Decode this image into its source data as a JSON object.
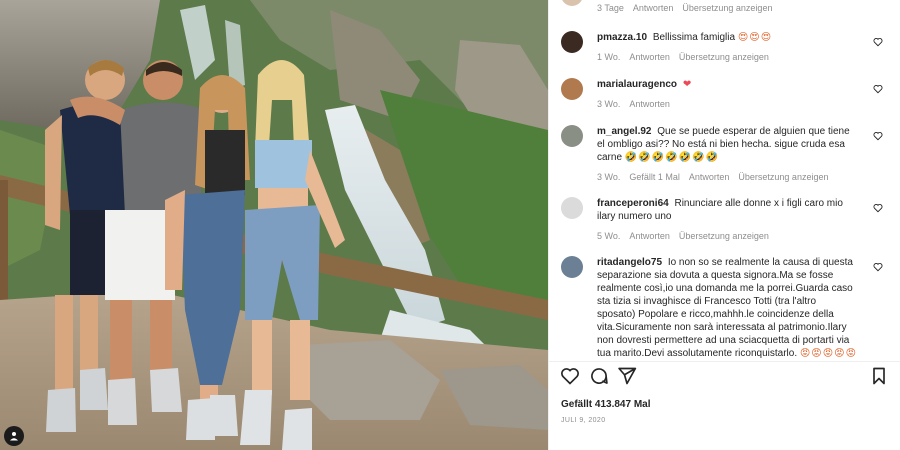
{
  "post": {
    "likes_text": "Gefällt 413.847 Mal",
    "date_text": "JULI 9, 2020"
  },
  "top_meta": {
    "time": "3 Tage",
    "reply": "Antworten",
    "translate": "Übersetzung anzeigen"
  },
  "comments": [
    {
      "user": "pmazza.10",
      "text": "Bellissima famiglia",
      "emoji": "😍😍😍",
      "time": "1 Wo.",
      "likes": "",
      "reply": "Antworten",
      "translate": "Übersetzung anzeigen",
      "avatar_color": "#3b2a22"
    },
    {
      "user": "marialauragenco",
      "text": "",
      "emoji": "❤",
      "time": "3 Wo.",
      "likes": "",
      "reply": "Antworten",
      "translate": "",
      "avatar_color": "#b07a4e"
    },
    {
      "user": "m_angel.92",
      "text": "Que se puede esperar de alguien que tiene el ombligo asi?? No está ni bien hecha. sigue cruda esa carne",
      "emoji": "🤣🤣🤣🤣🤣🤣🤣",
      "time": "3 Wo.",
      "likes": "Gefällt 1 Mal",
      "reply": "Antworten",
      "translate": "Übersetzung anzeigen",
      "avatar_color": "#8a8f86"
    },
    {
      "user": "franceperoni64",
      "text": "Rinunciare alle donne x i figli caro mio ilary numero uno",
      "emoji": "",
      "time": "5 Wo.",
      "likes": "",
      "reply": "Antworten",
      "translate": "Übersetzung anzeigen",
      "avatar_color": "#dbdbdb"
    },
    {
      "user": "ritadangelo75",
      "text": "Io non so se realmente la causa di questa separazione sia dovuta a questa signora.Ma se fosse realmente così,io una domanda me la porrei.Guarda caso sta tizia si invaghisce di Francesco Totti (tra l'altro sposato) Popolare e ricco,mahhh.le coincidenze della vita.Sicuramente non sarà interessata al patrimonio.Ilary non dovresti permettere ad una sciacquetta di portarti via tua marito.Devi assolutamente riconquistarlo.",
      "emoji": "😡😡😡😡😡",
      "time": "",
      "likes": "",
      "reply": "",
      "translate": "",
      "avatar_color": "#6b7f95"
    }
  ],
  "icons": {
    "like": "heart-outline-icon",
    "comment": "comment-icon",
    "share": "paper-plane-icon",
    "save": "bookmark-icon",
    "tag": "user-tag-icon"
  },
  "colors": {
    "text": "#262626",
    "muted": "#8e8e8e",
    "heart": "#ed4956"
  }
}
